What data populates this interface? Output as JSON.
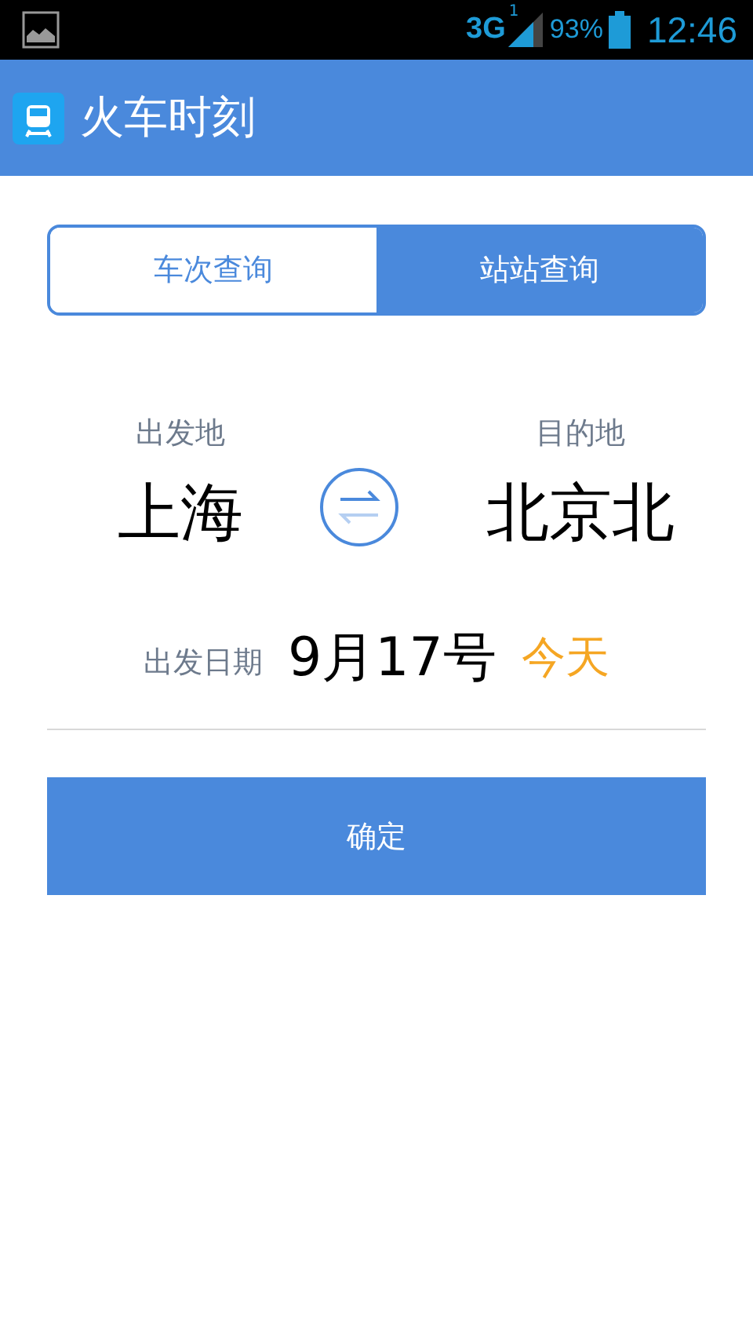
{
  "status_bar": {
    "network": "3G",
    "sim_slot": "1",
    "battery": "93%",
    "time": "12:46"
  },
  "app_bar": {
    "title": "火车时刻"
  },
  "tabs": [
    {
      "label": "车次查询",
      "selected": false
    },
    {
      "label": "站站查询",
      "selected": true
    }
  ],
  "from": {
    "label": "出发地",
    "station": "上海"
  },
  "to": {
    "label": "目的地",
    "station": "北京北"
  },
  "date": {
    "label": "出发日期",
    "value": "9月17号",
    "relative": "今天"
  },
  "confirm_button": "确定"
}
